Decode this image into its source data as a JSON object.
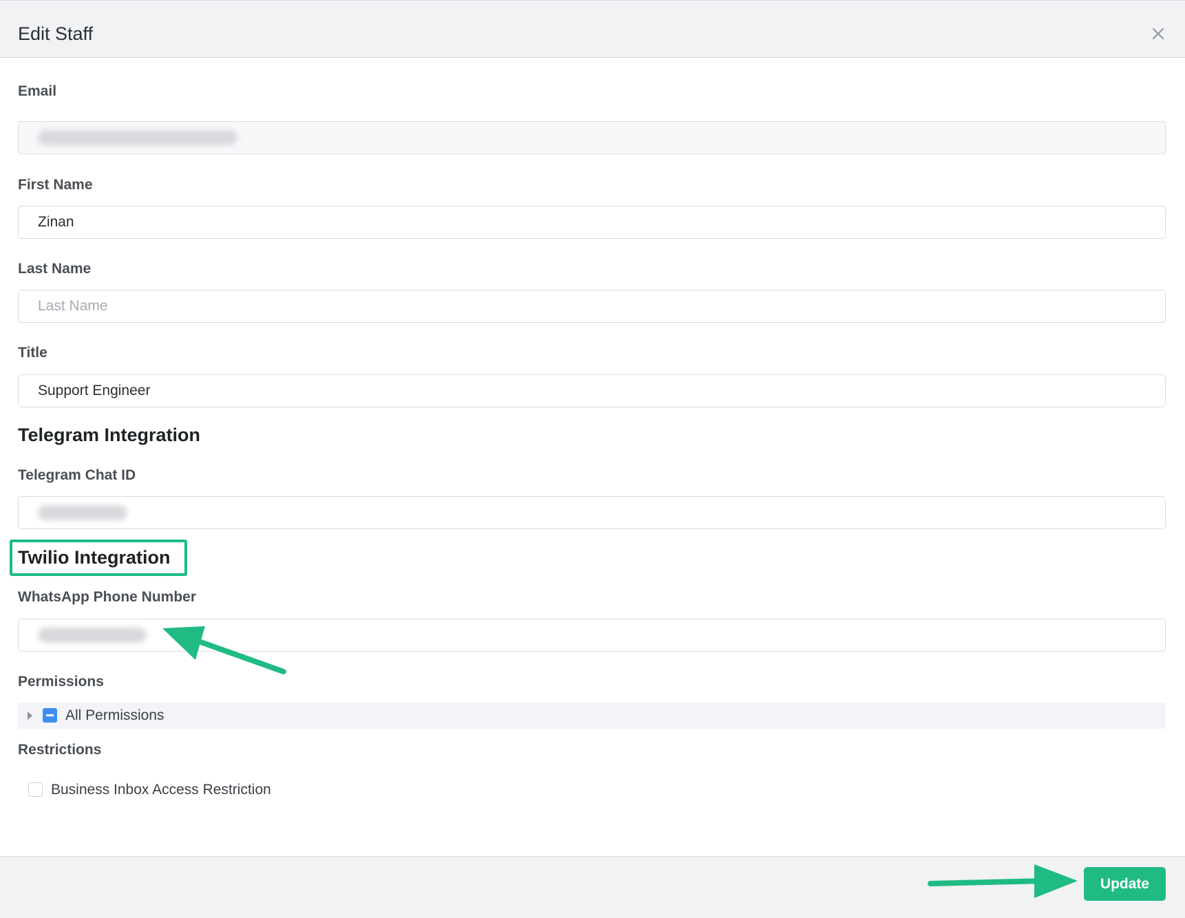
{
  "dialog": {
    "title": "Edit Staff",
    "close_icon": "close-icon"
  },
  "form": {
    "email": {
      "label": "Email",
      "value": "",
      "disabled": true
    },
    "first_name": {
      "label": "First Name",
      "value": "Zinan"
    },
    "last_name": {
      "label": "Last Name",
      "value": "",
      "placeholder": "Last Name"
    },
    "title": {
      "label": "Title",
      "value": "Support Engineer"
    }
  },
  "telegram": {
    "section_title": "Telegram Integration",
    "chat_id": {
      "label": "Telegram Chat ID",
      "value": ""
    }
  },
  "twilio": {
    "section_title": "Twilio Integration",
    "whatsapp": {
      "label": "WhatsApp Phone Number",
      "value": ""
    }
  },
  "permissions": {
    "label": "Permissions",
    "tree_item": {
      "label": "All Permissions",
      "state": "indeterminate",
      "expand_icon": "caret-right-icon"
    }
  },
  "restrictions": {
    "label": "Restrictions",
    "items": [
      {
        "label": "Business Inbox Access Restriction",
        "checked": false
      }
    ]
  },
  "footer": {
    "update_label": "Update"
  },
  "colors": {
    "accent": "#1fbb82",
    "checkbox_blue": "#3f8ff0",
    "header_bg": "#f1f2f4"
  }
}
